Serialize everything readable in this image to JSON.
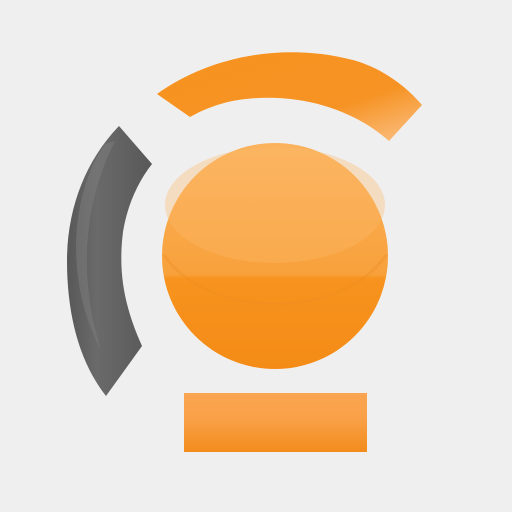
{
  "logo": {
    "icon_name": "app-logo-icon",
    "colors": {
      "background": "#f0efef",
      "orange": "#f7931e",
      "orange_light": "#fbb25d",
      "orange_dark": "#e9831b",
      "gray": "#585858",
      "gray_light": "#7b7b7b"
    }
  }
}
